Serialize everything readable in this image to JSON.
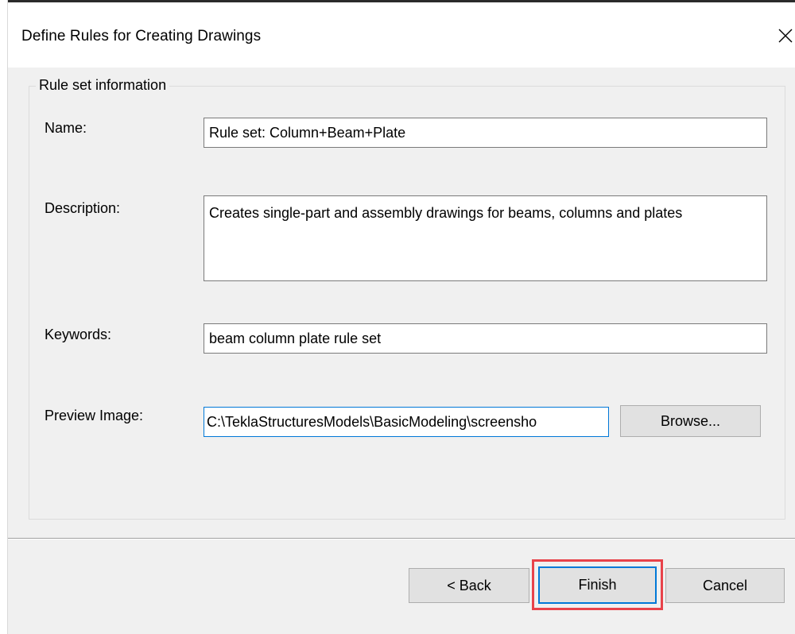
{
  "window": {
    "title": "Define Rules for Creating Drawings"
  },
  "group": {
    "legend": "Rule set information"
  },
  "fields": {
    "name_label": "Name:",
    "name_value": "Rule set: Column+Beam+Plate",
    "description_label": "Description:",
    "description_value": "Creates single-part and assembly drawings for beams, columns and plates",
    "keywords_label": "Keywords:",
    "keywords_value": "beam column plate rule set",
    "preview_label": "Preview Image:",
    "preview_value": "C:\\TeklaStructuresModels\\BasicModeling\\screensho"
  },
  "buttons": {
    "browse": "Browse...",
    "back": "< Back",
    "finish": "Finish",
    "cancel": "Cancel"
  },
  "colors": {
    "focus_blue": "#0078d7",
    "highlight_red": "#e8424a"
  },
  "icons": {
    "close": "close-icon"
  }
}
